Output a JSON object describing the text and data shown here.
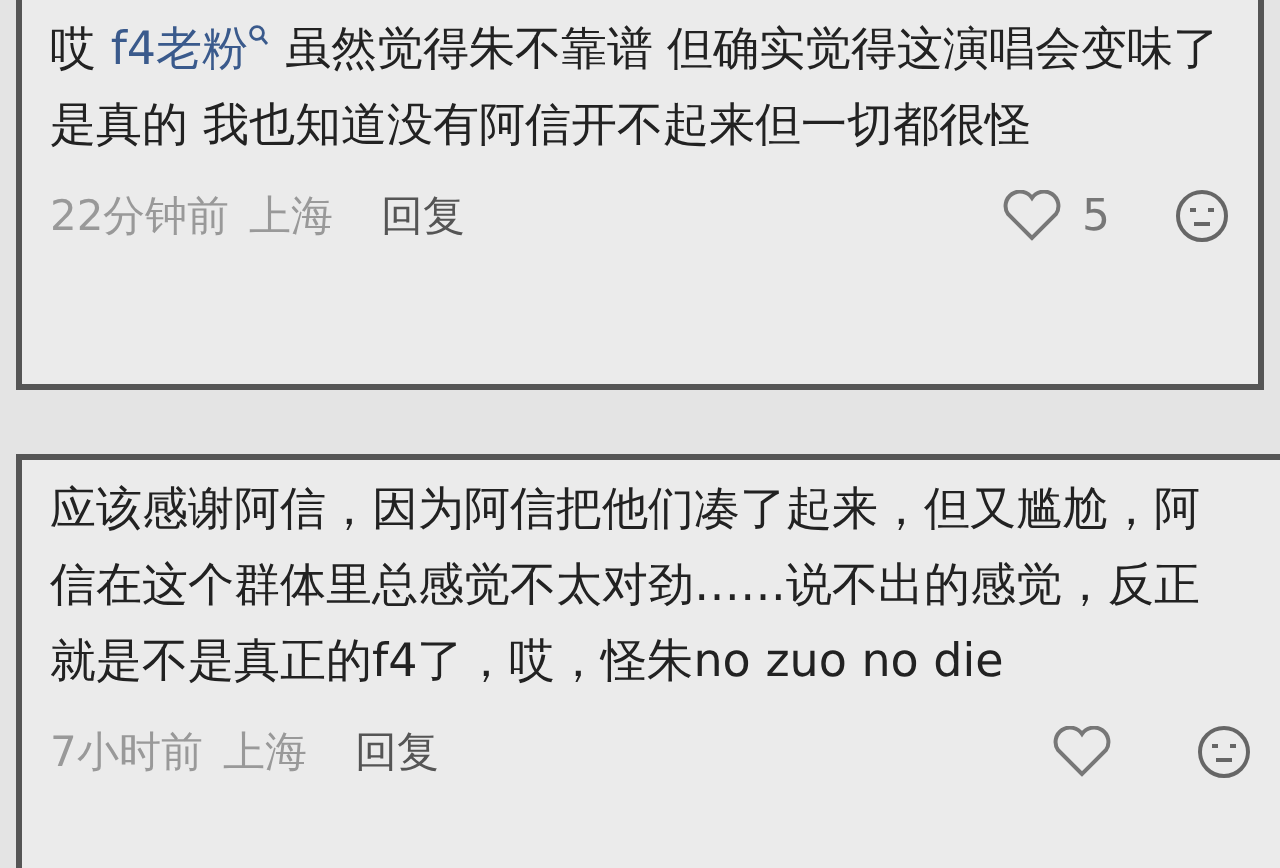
{
  "comments": [
    {
      "prefix": "哎",
      "author": "f4老粉",
      "text": "虽然觉得朱不靠谱 但确实觉得这演唱会变味了是真的 我也知道没有阿信开不起来但一切都很怪",
      "time": "22分钟前",
      "location": "上海",
      "reply": "回复",
      "likes": "5"
    },
    {
      "text": "应该感谢阿信，因为阿信把他们凑了起来，但又尴尬，阿信在这个群体里总感觉不太对劲……说不出的感觉，反正就是不是真正的f4了，哎，怪朱no zuo no die",
      "time": "7小时前",
      "location": "上海",
      "reply": "回复"
    }
  ]
}
